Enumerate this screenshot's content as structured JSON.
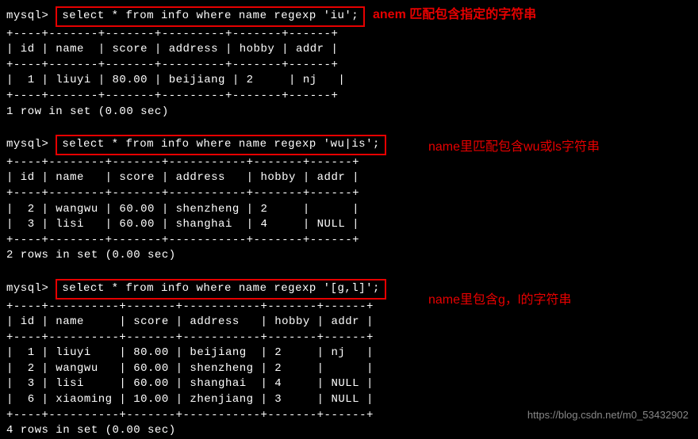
{
  "prompt": "mysql>",
  "block1": {
    "query": "select * from info where name regexp 'iu';",
    "header_sep": "+----+-------+-------+---------+-------+------+",
    "header": "| id | name  | score | address | hobby | addr |",
    "rows": [
      "|  1 | liuyi | 80.00 | beijiang | 2     | nj   |"
    ],
    "footer": "1 row in set (0.00 sec)",
    "annotation": "anem 匹配包含指定的字符串"
  },
  "block2": {
    "query": "select * from info where name regexp 'wu|is';",
    "header_sep": "+----+--------+-------+-----------+-------+------+",
    "header": "| id | name   | score | address   | hobby | addr |",
    "rows": [
      "|  2 | wangwu | 60.00 | shenzheng | 2     |      |",
      "|  3 | lisi   | 60.00 | shanghai  | 4     | NULL |"
    ],
    "footer": "2 rows in set (0.00 sec)",
    "annotation": "name里匹配包含wu或ls字符串"
  },
  "block3": {
    "query": "select * from info where name regexp '[g,l]';",
    "header_sep": "+----+----------+-------+-----------+-------+------+",
    "header": "| id | name     | score | address   | hobby | addr |",
    "rows": [
      "|  1 | liuyi    | 80.00 | beijiang  | 2     | nj   |",
      "|  2 | wangwu   | 60.00 | shenzheng | 2     |      |",
      "|  3 | lisi     | 60.00 | shanghai  | 4     | NULL |",
      "|  6 | xiaoming | 10.00 | zhenjiang | 3     | NULL |"
    ],
    "footer": "4 rows in set (0.00 sec)",
    "annotation": "name里包含g，l的字符串"
  },
  "watermark": "https://blog.csdn.net/m0_53432902",
  "chart_data": {
    "type": "table",
    "tables": [
      {
        "query": "select * from info where name regexp 'iu';",
        "columns": [
          "id",
          "name",
          "score",
          "address",
          "hobby",
          "addr"
        ],
        "rows": [
          {
            "id": 1,
            "name": "liuyi",
            "score": 80.0,
            "address": "beijiang",
            "hobby": 2,
            "addr": "nj"
          }
        ],
        "rows_in_set": 1,
        "time_sec": 0.0
      },
      {
        "query": "select * from info where name regexp 'wu|is';",
        "columns": [
          "id",
          "name",
          "score",
          "address",
          "hobby",
          "addr"
        ],
        "rows": [
          {
            "id": 2,
            "name": "wangwu",
            "score": 60.0,
            "address": "shenzheng",
            "hobby": 2,
            "addr": ""
          },
          {
            "id": 3,
            "name": "lisi",
            "score": 60.0,
            "address": "shanghai",
            "hobby": 4,
            "addr": "NULL"
          }
        ],
        "rows_in_set": 2,
        "time_sec": 0.0
      },
      {
        "query": "select * from info where name regexp '[g,l]';",
        "columns": [
          "id",
          "name",
          "score",
          "address",
          "hobby",
          "addr"
        ],
        "rows": [
          {
            "id": 1,
            "name": "liuyi",
            "score": 80.0,
            "address": "beijiang",
            "hobby": 2,
            "addr": "nj"
          },
          {
            "id": 2,
            "name": "wangwu",
            "score": 60.0,
            "address": "shenzheng",
            "hobby": 2,
            "addr": ""
          },
          {
            "id": 3,
            "name": "lisi",
            "score": 60.0,
            "address": "shanghai",
            "hobby": 4,
            "addr": "NULL"
          },
          {
            "id": 6,
            "name": "xiaoming",
            "score": 10.0,
            "address": "zhenjiang",
            "hobby": 3,
            "addr": "NULL"
          }
        ],
        "rows_in_set": 4,
        "time_sec": 0.0
      }
    ]
  }
}
